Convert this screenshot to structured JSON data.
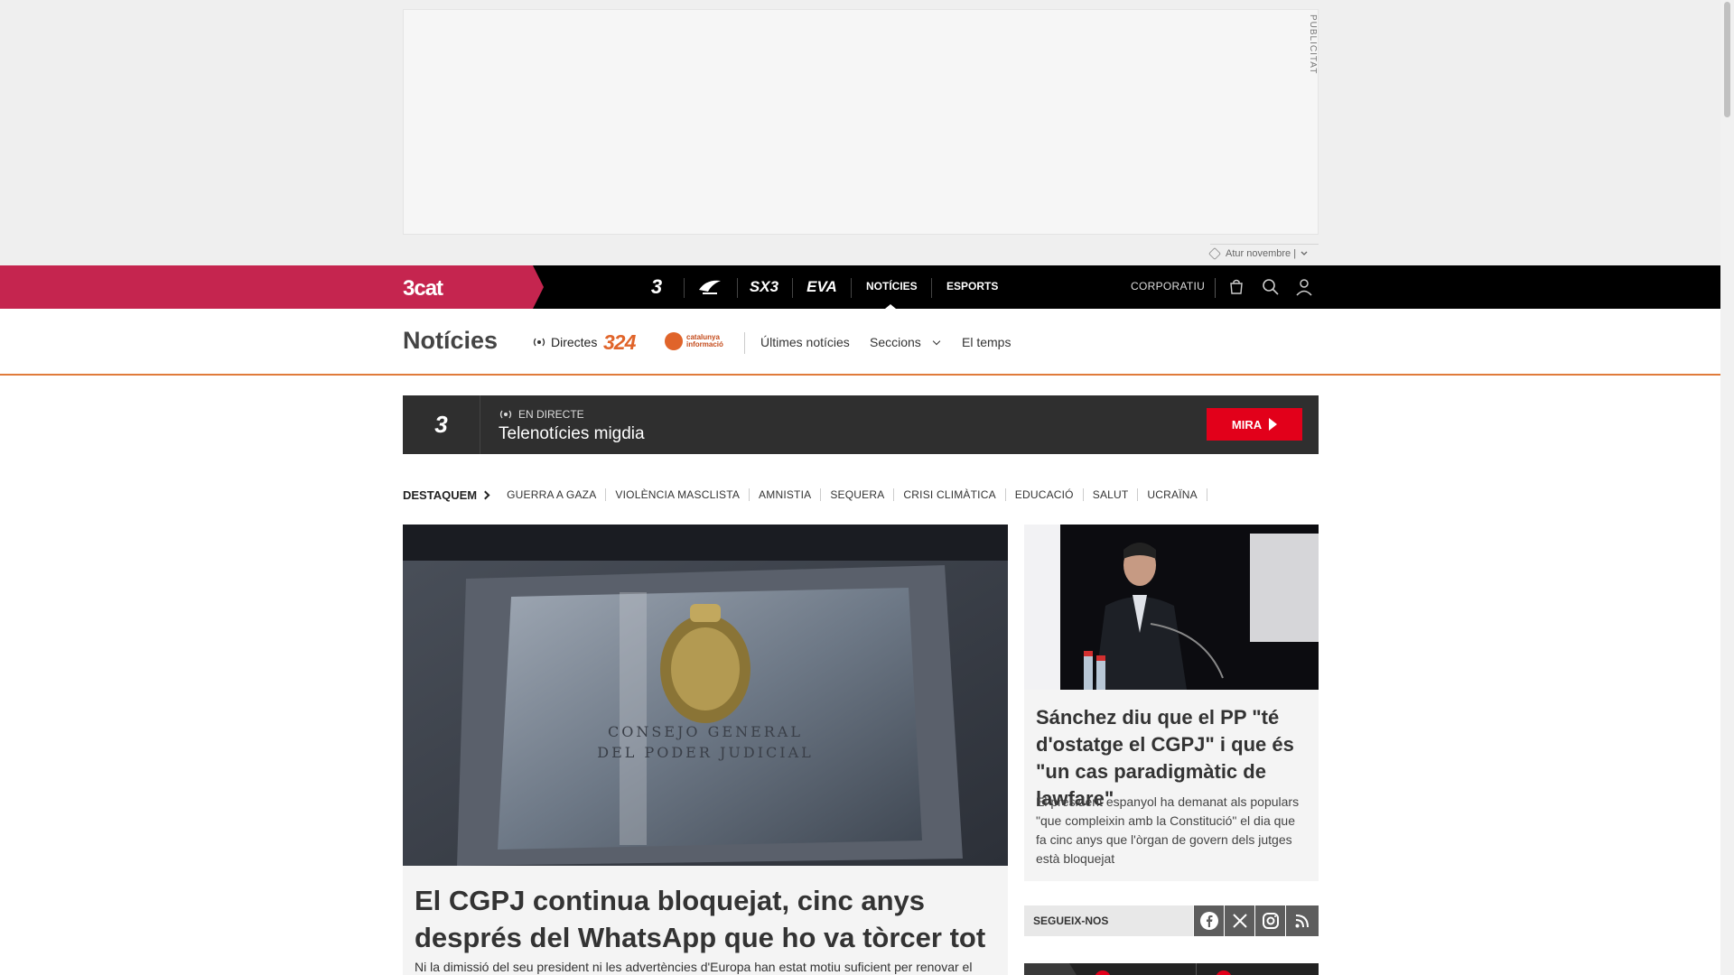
{
  "ad": {
    "label": "PUBLICITAT",
    "report": "Atur novembre |"
  },
  "topnav": {
    "brand": "3cat",
    "channels": [
      {
        "name": "tv3",
        "label": "3"
      },
      {
        "name": "catradio",
        "label": "CatRàdio"
      },
      {
        "name": "sx3",
        "label": "SX3"
      },
      {
        "name": "eva",
        "label": "EVA"
      }
    ],
    "links": [
      "NOTÍCIES",
      "ESPORTS"
    ],
    "corporatiu": "CORPORATIU"
  },
  "section": {
    "title": "Notícies",
    "directes": "Directes",
    "logo_324": "324",
    "logo_ci": "catalunya informació",
    "links": [
      "Últimes notícies",
      "Seccions",
      "El temps"
    ]
  },
  "live": {
    "channel": "3",
    "tag": "EN DIRECTE",
    "show": "Telenotícies migdia",
    "button": "MIRA"
  },
  "destaquem": {
    "label": "DESTAQUEM",
    "tags": [
      "GUERRA A GAZA",
      "VIOLÈNCIA MASCLISTA",
      "AMNISTIA",
      "SEQUERA",
      "CRISI CLIMÀTICA",
      "EDUCACIÓ",
      "SALUT",
      "UCRAÏNA"
    ]
  },
  "main_article": {
    "image_text": "CONSEJO GENERAL DEL PODER JUDICIAL",
    "headline": "El CGPJ continua bloquejat, cinc anys després del WhatsApp que ho va tòrcer tot",
    "sub": "Ni la dimissió del seu president ni les advertències d'Europa han estat motiu suficient per renovar el"
  },
  "side_article": {
    "headline": "Sánchez diu que el PP \"té d'ostatge el CGPJ\" i que és \"un cas paradigmàtic de lawfare\"",
    "sub": "El president espanyol ha demanat als populars \"que compleixin amb la Constitució\" el dia que fa cinc anys que l'òrgan de govern dels jutges està bloquejat"
  },
  "follow": {
    "label": "SEGUEIX-NOS",
    "icons": [
      "facebook-icon",
      "x-icon",
      "instagram-icon",
      "rss-icon"
    ]
  },
  "colors": {
    "brand": "#c5254f",
    "accent": "#e2001a",
    "orange": "#e07b3a"
  }
}
